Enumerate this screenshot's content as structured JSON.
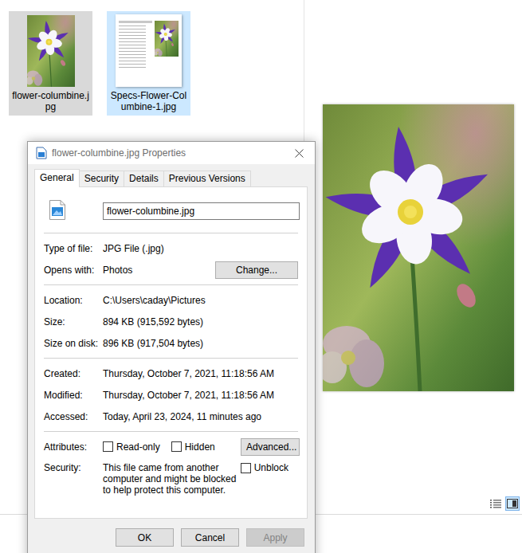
{
  "explorer": {
    "files": [
      {
        "name": "flower-columbine.jpg",
        "kind": "photo",
        "selected": true,
        "hovered": false
      },
      {
        "name": "Specs-Flower-Columbine-1.jpg",
        "kind": "document",
        "selected": false,
        "hovered": true
      }
    ],
    "view_modes": [
      {
        "kind": "details",
        "selected": false
      },
      {
        "kind": "large-preview",
        "selected": true
      }
    ]
  },
  "dialog": {
    "title": "flower-columbine.jpg Properties",
    "active": false,
    "tabs": [
      {
        "label": "General",
        "selected": true
      },
      {
        "label": "Security",
        "selected": false
      },
      {
        "label": "Details",
        "selected": false
      },
      {
        "label": "Previous Versions",
        "selected": false
      }
    ],
    "file_name": "flower-columbine.jpg",
    "groups": [
      [
        {
          "label": "Type of file:",
          "value": "JPG File (.jpg)"
        },
        {
          "label": "Opens with:",
          "value": "Photos",
          "button": "Change..."
        }
      ],
      [
        {
          "label": "Location:",
          "value": "C:\\Users\\caday\\Pictures"
        },
        {
          "label": "Size:",
          "value": "894 KB (915,592 bytes)"
        },
        {
          "label": "Size on disk:",
          "value": "896 KB (917,504 bytes)"
        }
      ],
      [
        {
          "label": "Created:",
          "value": "Thursday, October 7, 2021, 11:18:56 AM"
        },
        {
          "label": "Modified:",
          "value": "Thursday, October 7, 2021, 11:18:56 AM"
        },
        {
          "label": "Accessed:",
          "value": "Today, April 23, 2024, 11 minutes ago"
        }
      ]
    ],
    "attributes": {
      "label": "Attributes:",
      "checkboxes": [
        {
          "label": "Read-only",
          "checked": false
        },
        {
          "label": "Hidden",
          "checked": false
        }
      ],
      "button": "Advanced..."
    },
    "security": {
      "label": "Security:",
      "text": "This file came from another computer and might be blocked to help protect this computer.",
      "checkbox": {
        "label": "Unblock",
        "checked": false
      }
    },
    "buttons": [
      {
        "label": "OK",
        "disabled": false
      },
      {
        "label": "Cancel",
        "disabled": false
      },
      {
        "label": "Apply",
        "disabled": true
      }
    ]
  }
}
